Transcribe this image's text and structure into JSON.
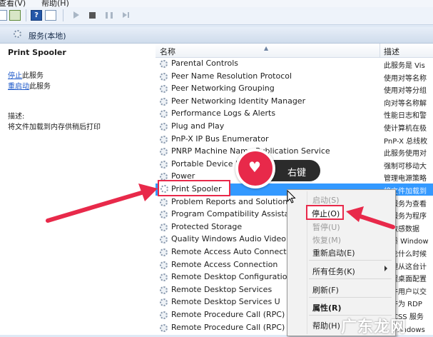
{
  "menubar": {
    "items": [
      "查看(V)",
      "帮助(H)"
    ]
  },
  "header": {
    "title": "服务(本地)"
  },
  "left_panel": {
    "service_name": "Print Spooler",
    "stop_link": "停止",
    "stop_suffix": "此服务",
    "restart_link": "重启动",
    "restart_suffix": "此服务",
    "desc_label": "描述:",
    "desc_text": "将文件加载到内存供稍后打印"
  },
  "list": {
    "col_name": "名称",
    "col_desc": "描述",
    "rows": [
      {
        "name": "Parental Controls",
        "desc": "此服务是 Vis"
      },
      {
        "name": "Peer Name Resolution Protocol",
        "desc": "使用对等名称"
      },
      {
        "name": "Peer Networking Grouping",
        "desc": "使用对等分组"
      },
      {
        "name": "Peer Networking Identity Manager",
        "desc": "向对等名称解"
      },
      {
        "name": "Performance Logs & Alerts",
        "desc": "性能日志和警"
      },
      {
        "name": "Plug and Play",
        "desc": "使计算机在极"
      },
      {
        "name": "PnP-X IP Bus Enumerator",
        "desc": "PnP-X 总线枚"
      },
      {
        "name": "PNRP Machine Name Publication Service",
        "desc": "此服务使用对"
      },
      {
        "name": "Portable Device Enumerator Service",
        "desc": "强制可移动大"
      },
      {
        "name": "Power",
        "desc": "管理电源策略"
      },
      {
        "name": "Print Spooler",
        "desc": "将文件加载到"
      },
      {
        "name": "Problem Reports and Solutions",
        "desc": "此服务为查看"
      },
      {
        "name": "Program Compatibility Assistant",
        "desc": "此服务为程序"
      },
      {
        "name": "Protected Storage",
        "desc": "为敏感数据"
      },
      {
        "name": "Quality Windows Audio Video",
        "desc": "优质 Window"
      },
      {
        "name": "Remote Access Auto Connection",
        "desc": "无论什么时候"
      },
      {
        "name": "Remote Access Connection",
        "desc": "管理从这台计"
      },
      {
        "name": "Remote Desktop Configuration",
        "desc": "远程桌面配置"
      },
      {
        "name": "Remote Desktop Services",
        "desc": "允许用户以交"
      },
      {
        "name": "Remote Desktop Services U",
        "desc": "允许为 RDP"
      },
      {
        "name": "Remote Procedure Call (RPC)",
        "desc": "RPCSS 服务"
      },
      {
        "name": "Remote Procedure Call (RPC)",
        "desc": "在 Windows"
      }
    ]
  },
  "badge": {
    "label": "右键"
  },
  "context_menu": {
    "start": "启动(S)",
    "stop": "停止(O)",
    "pause": "暂停(U)",
    "resume": "恢复(M)",
    "restart": "重新启动(E)",
    "all_tasks": "所有任务(K)",
    "refresh": "刷新(F)",
    "properties": "属性(R)",
    "help": "帮助(H)"
  },
  "watermark": "广东龙网",
  "colors": {
    "highlight": "#e8294a",
    "selection": "#3399ff"
  }
}
